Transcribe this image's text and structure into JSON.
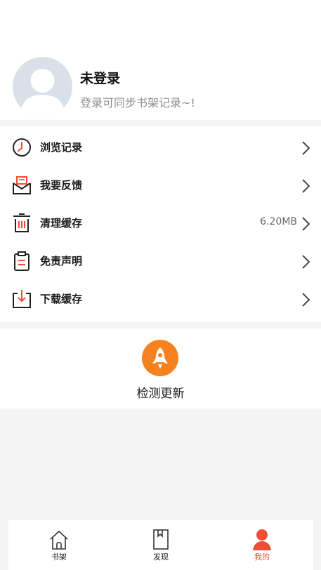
{
  "profile": {
    "name": "未登录",
    "subtitle": "登录可同步书架记录~!"
  },
  "menu": [
    {
      "label": "浏览记录",
      "icon": "clock-icon",
      "value": ""
    },
    {
      "label": "我要反馈",
      "icon": "envelope-icon",
      "value": ""
    },
    {
      "label": "清理缓存",
      "icon": "trash-icon",
      "value": "6.20MB"
    },
    {
      "label": "免责声明",
      "icon": "clipboard-icon",
      "value": ""
    },
    {
      "label": "下载缓存",
      "icon": "download-icon",
      "value": ""
    }
  ],
  "update": {
    "label": "检测更新",
    "icon": "rocket-icon"
  },
  "tabbar": {
    "tabs": [
      {
        "label": "书架",
        "icon": "house-icon",
        "active": false
      },
      {
        "label": "发现",
        "icon": "book-icon",
        "active": false
      },
      {
        "label": "我的",
        "icon": "person-icon",
        "active": true
      }
    ]
  },
  "colors": {
    "accent": "#f04d36",
    "update_icon": "#f5821f",
    "background": "#f4f4f5"
  }
}
